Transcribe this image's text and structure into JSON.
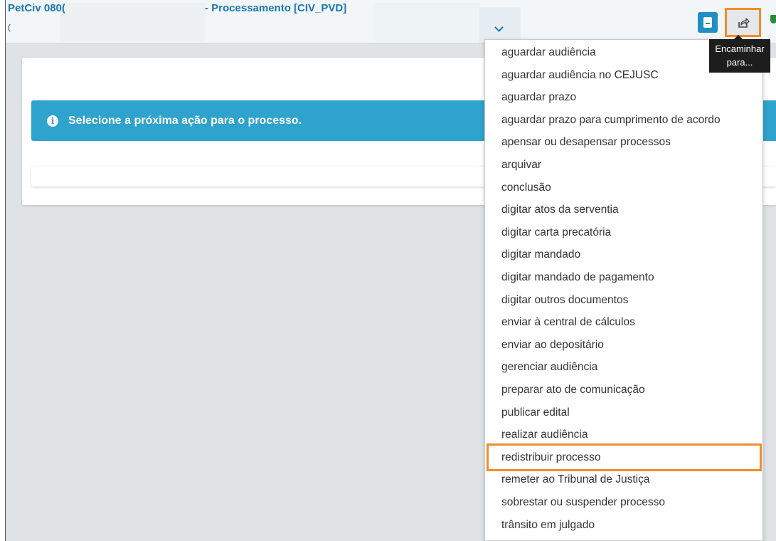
{
  "header": {
    "title_prefix": "PetCiv 080(",
    "title_suffix": "- Processamento [CIV_PVD]",
    "subtitle": "("
  },
  "toolbar": {
    "tooltip": "Encaminhar para...",
    "tooltip_line1": "Encaminhar",
    "tooltip_line2": "para..."
  },
  "alert": {
    "icon": "info-circle-icon",
    "message": "Selecione a próxima ação para o processo."
  },
  "colors": {
    "accent": "#1a77b6",
    "alert_bg": "#2ea3cd",
    "highlight": "#f28c28"
  },
  "menu": {
    "items": [
      "aguardar audiência",
      "aguardar audiência no CEJUSC",
      "aguardar prazo",
      "aguardar prazo para cumprimento de acordo",
      "apensar ou desapensar processos",
      "arquivar",
      "conclusão",
      "digitar atos da serventia",
      "digitar carta precatória",
      "digitar mandado",
      "digitar mandado de pagamento",
      "digitar outros documentos",
      "enviar à central de cálculos",
      "enviar ao depositário",
      "gerenciar audiência",
      "preparar ato de comunicação",
      "publicar edital",
      "realizar audiência",
      "redistribuir processo",
      "remeter ao Tribunal de Justiça",
      "sobrestar ou suspender processo",
      "trânsito em julgado"
    ],
    "highlighted": "redistribuir processo"
  }
}
